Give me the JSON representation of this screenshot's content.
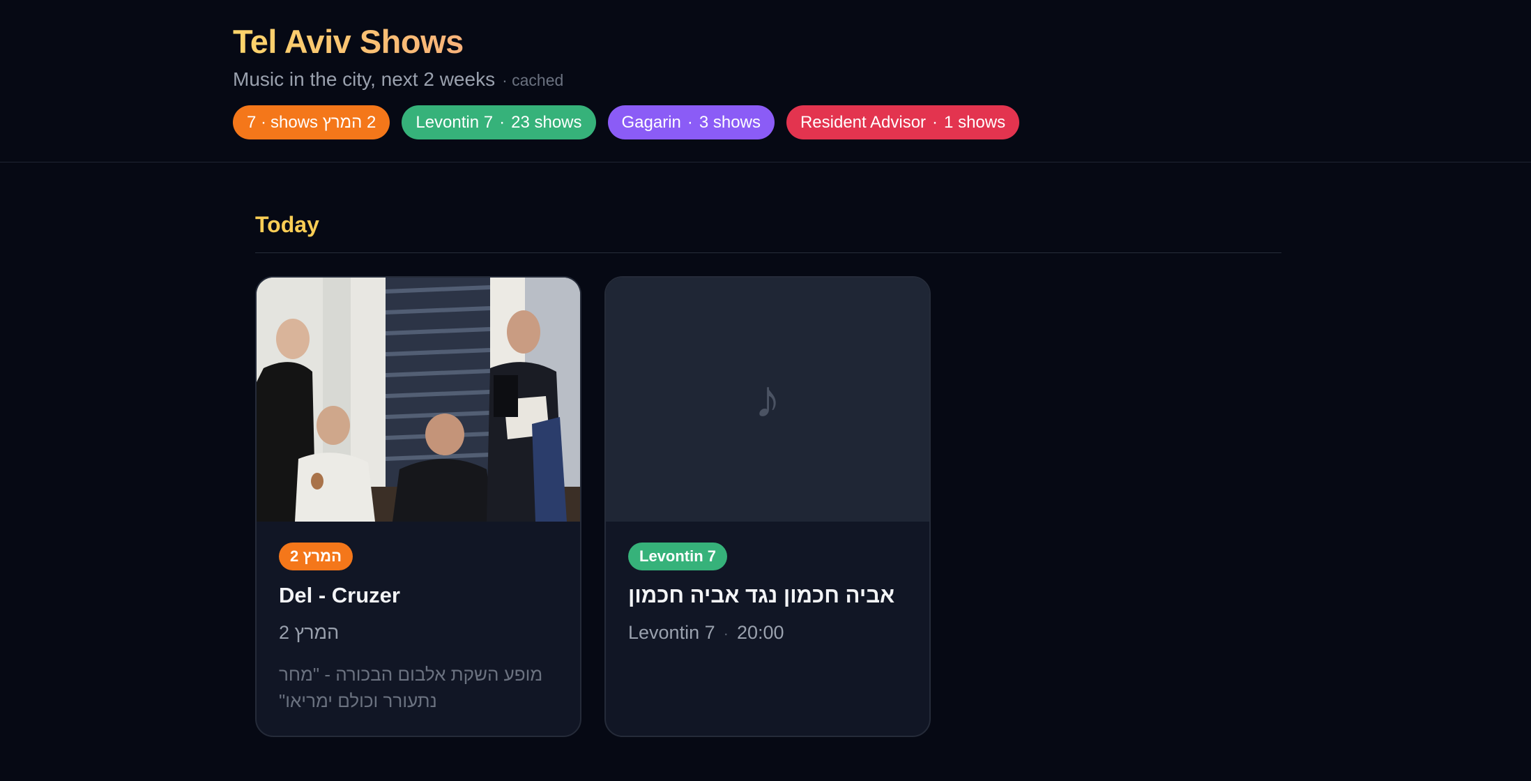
{
  "header": {
    "title": "Tel Aviv Shows",
    "subtitle": "Music in the city, next 2 weeks",
    "cache_status": "· cached"
  },
  "venues": [
    {
      "name": "המרץ 2",
      "prefix": "7 · ",
      "count_label": "2 המרץ shows",
      "color": "#f4771a"
    },
    {
      "name": "Levontin 7",
      "count_label": "23 shows",
      "color": "#36b27a"
    },
    {
      "name": "Gagarin",
      "count_label": "3 shows",
      "color": "#8b5cf6"
    },
    {
      "name": "Resident Advisor",
      "count_label": "1 shows",
      "color": "#e3344f"
    }
  ],
  "chip_separator": "·",
  "sections": [
    {
      "heading": "Today",
      "events": [
        {
          "venue_badge": "המרץ 2",
          "title": "Del - Cruzer",
          "meta_venue": "המרץ 2",
          "description": "מופע השקת אלבום הבכורה - \"מחר נתעורר וכולם ימריאו\"",
          "image": "band-photo"
        },
        {
          "venue_badge": "Levontin 7",
          "title": "אביה חכמון נגד אביה חכמון",
          "meta_venue": "Levontin 7",
          "meta_dot": "·",
          "meta_time": "20:00",
          "image": "placeholder",
          "placeholder_icon": "music-note-icon",
          "placeholder_glyph": "♪"
        }
      ]
    }
  ]
}
